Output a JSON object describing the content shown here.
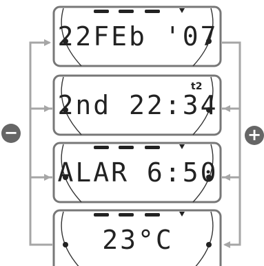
{
  "screens": [
    {
      "display": "22FEb '07",
      "superscript": ""
    },
    {
      "display": "2nd 22:34",
      "superscript": "t2"
    },
    {
      "display": "ALAR 6:50",
      "superscript": ""
    },
    {
      "display": "23°C",
      "superscript": ""
    }
  ],
  "buttons": {
    "minus": "−",
    "plus": "+"
  },
  "colors": {
    "frame": "#777777",
    "arrow": "#a6a6a6",
    "lcd_text": "#222222",
    "button": "#666666"
  }
}
